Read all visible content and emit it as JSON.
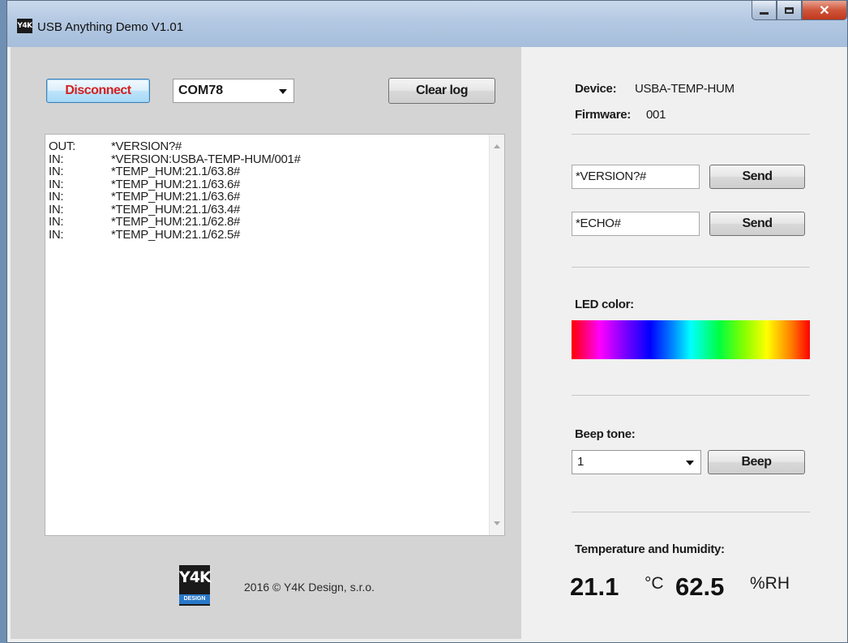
{
  "window": {
    "title": "USB Anything Demo V1.01",
    "logo_text": "Y4K"
  },
  "left": {
    "disconnect_label": "Disconnect",
    "com_port": "COM78",
    "clear_label": "Clear log",
    "log": [
      {
        "dir": "OUT:",
        "msg": "*VERSION?#"
      },
      {
        "dir": "IN:",
        "msg": "*VERSION:USBA-TEMP-HUM/001#"
      },
      {
        "dir": "IN:",
        "msg": "*TEMP_HUM:21.1/63.8#"
      },
      {
        "dir": "IN:",
        "msg": "*TEMP_HUM:21.1/63.6#"
      },
      {
        "dir": "IN:",
        "msg": "*TEMP_HUM:21.1/63.6#"
      },
      {
        "dir": "IN:",
        "msg": "*TEMP_HUM:21.1/63.4#"
      },
      {
        "dir": "IN:",
        "msg": "*TEMP_HUM:21.1/62.8#"
      },
      {
        "dir": "IN:",
        "msg": "*TEMP_HUM:21.1/62.5#"
      }
    ],
    "footer_logo_big": "Y4K",
    "footer_logo_small": "DESIGN",
    "footer_text": "2016 © Y4K Design, s.r.o."
  },
  "right": {
    "device_label": "Device:",
    "device_value": "USBA-TEMP-HUM",
    "firmware_label": "Firmware:",
    "firmware_value": "001",
    "cmd1_value": "*VERSION?#",
    "cmd2_value": "*ECHO#",
    "send_label": "Send",
    "led_label": "LED color:",
    "beep_label": "Beep tone:",
    "beep_value": "1",
    "beep_button": "Beep",
    "th_label": "Temperature and humidity:",
    "temperature": "21.1",
    "temp_unit": "°C",
    "humidity": "62.5",
    "hum_unit": "%RH"
  },
  "colors": {
    "disconnect_text": "#d32020",
    "left_panel_bg": "#d4d4d4",
    "right_panel_bg": "#f0f0f0"
  }
}
